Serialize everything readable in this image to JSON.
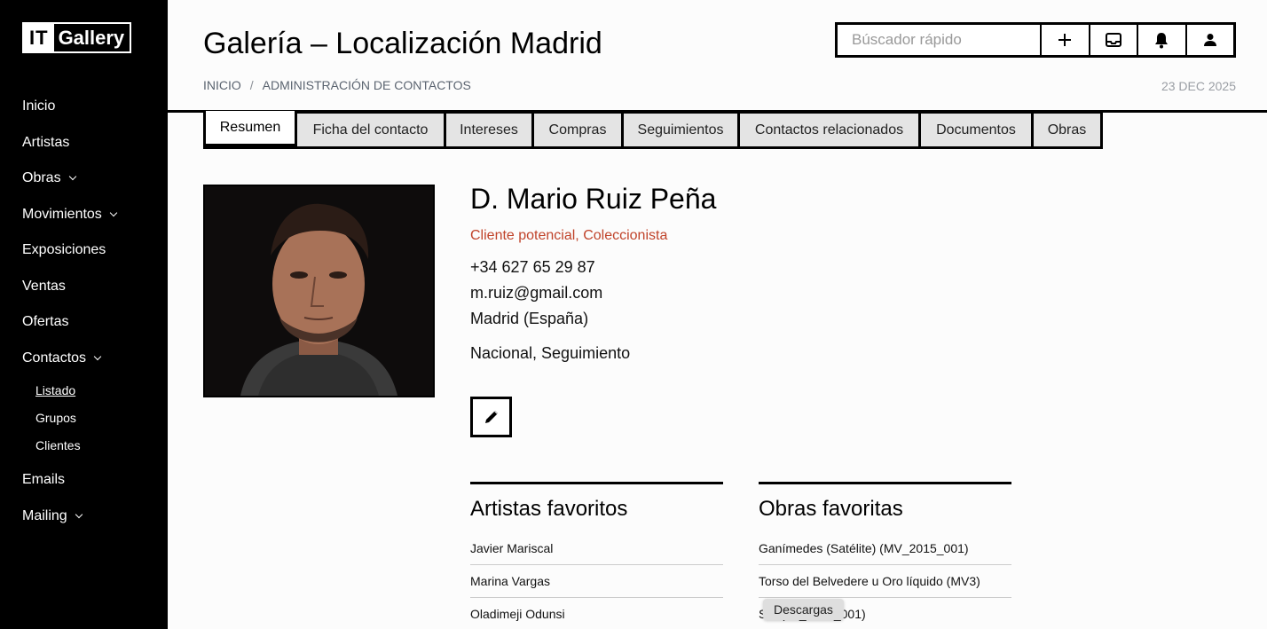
{
  "logo": {
    "part1": "IT",
    "part2": "Gallery"
  },
  "sidebar": {
    "items": [
      {
        "label": "Inicio"
      },
      {
        "label": "Artistas"
      },
      {
        "label": "Obras"
      },
      {
        "label": "Movimientos"
      },
      {
        "label": "Exposiciones"
      },
      {
        "label": "Ventas"
      },
      {
        "label": "Ofertas"
      },
      {
        "label": "Contactos"
      },
      {
        "label": "Emails"
      },
      {
        "label": "Mailing"
      }
    ],
    "contactos_sub": [
      {
        "label": "Listado"
      },
      {
        "label": "Grupos"
      },
      {
        "label": "Clientes"
      }
    ]
  },
  "header": {
    "title": "Galería – Localización Madrid",
    "breadcrumb": [
      "INICIO",
      "ADMINISTRACIÓN DE CONTACTOS"
    ],
    "breadcrumb_sep": "/",
    "date": "23 DEC 2025",
    "search_placeholder": "Búscador rápido"
  },
  "tabs": [
    {
      "label": "Resumen"
    },
    {
      "label": "Ficha del contacto"
    },
    {
      "label": "Intereses"
    },
    {
      "label": "Compras"
    },
    {
      "label": "Seguimientos"
    },
    {
      "label": "Contactos relacionados"
    },
    {
      "label": "Documentos"
    },
    {
      "label": "Obras"
    }
  ],
  "contact": {
    "name": "D. Mario Ruiz Peña",
    "type": "Cliente potencial, Coleccionista",
    "phone": "+34 627 65 29 87",
    "email": "m.ruiz@gmail.com",
    "location": "Madrid (España)",
    "tags": "Nacional, Seguimiento"
  },
  "favorites": {
    "artists_title": "Artistas favoritos",
    "artists": [
      "Javier Mariscal",
      "Marina Vargas",
      "Oladimeji Odunsi"
    ],
    "works_title": "Obras favoritas",
    "works": [
      "Ganímedes (Satélite) (MV_2015_001)",
      "Torso del Belvedere u Oro líquido (MV3)",
      "S                   d (JA_2012_001)"
    ]
  },
  "tooltip": "Descargas",
  "colors": {
    "accent": "#c0432a",
    "sidebar": "#000000"
  }
}
